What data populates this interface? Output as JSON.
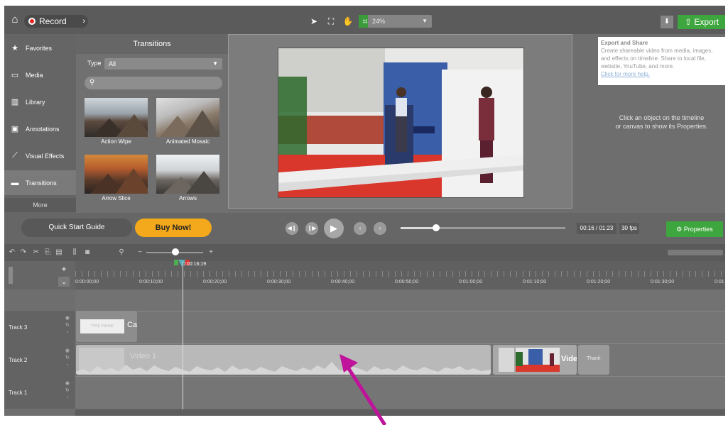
{
  "topbar": {
    "record_label": "Record",
    "zoom_value": "24%",
    "export_label": "Export"
  },
  "nav": {
    "items": [
      {
        "label": "Favorites",
        "icon": "star-icon"
      },
      {
        "label": "Media",
        "icon": "media-icon"
      },
      {
        "label": "Library",
        "icon": "library-icon"
      },
      {
        "label": "Annotations",
        "icon": "annotations-icon"
      },
      {
        "label": "Visual Effects",
        "icon": "wand-icon"
      },
      {
        "label": "Transitions",
        "icon": "transitions-icon"
      }
    ],
    "more_label": "More"
  },
  "transitions": {
    "title": "Transitions",
    "type_label": "Type",
    "type_value": "All",
    "items": [
      {
        "label": "Action Wipe"
      },
      {
        "label": "Animated Mosaic"
      },
      {
        "label": "Arrow Slice"
      },
      {
        "label": "Arrows"
      }
    ]
  },
  "properties": {
    "tooltip_title": "Export and Share",
    "tooltip_body": "Create shareable video from media, images, and effects on timeline. Share to local file, website, YouTube, and more.",
    "tooltip_link": "Click for more help.",
    "hint_line1": "Click an object on the timeline",
    "hint_line2": "or canvas to show its Properties."
  },
  "transport": {
    "quick_start_label": "Quick Start Guide",
    "buy_now_label": "Buy Now!",
    "timecode": "00:16 / 01:23",
    "fps": "30 fps",
    "properties_label": "Properties",
    "progress_fraction": 0.19
  },
  "timeline": {
    "playhead_time": "0:00:16;19",
    "ruler_labels": [
      "0:00:00;00",
      "0:00:10;00",
      "0:00:20;00",
      "0:00:30;00",
      "0:00:40;00",
      "0:00:50;00",
      "0:01:00;00",
      "0:01:10;00",
      "0:01:20;00",
      "0:01:30;00",
      "0:01"
    ],
    "tracks": [
      {
        "label": "Track 3"
      },
      {
        "label": "Track 2"
      },
      {
        "label": "Track 1"
      }
    ],
    "clips": {
      "callout_name": "Ca",
      "callout_text": "TYPE PHONE",
      "video1_name": "Video 1",
      "video2_name": "Vide",
      "thanks_name": "Thank"
    }
  },
  "colors": {
    "accent_green": "#3ea63e",
    "buy_orange": "#f3a91b",
    "record_red": "#e22222",
    "annotation_arrow": "#c0139b"
  }
}
